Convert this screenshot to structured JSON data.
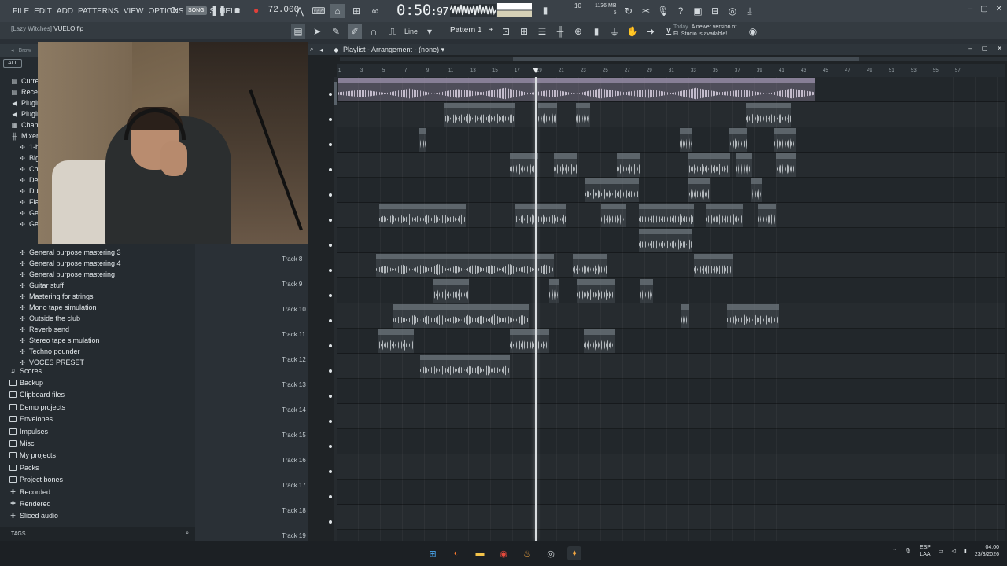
{
  "menu": [
    "FILE",
    "EDIT",
    "ADD",
    "PATTERNS",
    "VIEW",
    "OPTIONS",
    "TOOLS",
    "HELP"
  ],
  "transport": {
    "mode_label": "SONG",
    "tempo": "72.000",
    "time_main": "0:50",
    "time_fraction": ":97"
  },
  "cpu": {
    "memory": "1136 MB",
    "voices": "5",
    "top_value": "10"
  },
  "subbar": {
    "project_prefix": "[Lazy Witches]",
    "project_file": "VUELO.flp",
    "snap": "Line",
    "pattern": "Pattern 1",
    "news_today": "Today",
    "news_line1": "A newer version of",
    "news_line2": "FL Studio is available!"
  },
  "browser": {
    "head_label": "Brow",
    "filter_all": "ALL",
    "top_items": [
      {
        "label": "Curre",
        "icon": "folder-icon"
      },
      {
        "label": "Recen",
        "icon": "folder-icon"
      },
      {
        "label": "Plugin",
        "icon": "plugin-icon"
      },
      {
        "label": "Plugin",
        "icon": "plugin-icon"
      },
      {
        "label": "Chann",
        "icon": "channel-icon"
      },
      {
        "label": "Mixer",
        "icon": "mixer-icon"
      }
    ],
    "sub_items": [
      "1-b",
      "Big",
      "Cho",
      "Def",
      "Dua",
      "Fla",
      "Ger",
      "Ger"
    ],
    "fx_presets": [
      "General purpose mastering 3",
      "General purpose mastering 4",
      "General purpose mastering",
      "Guitar stuff",
      "Mastering for strings",
      "Mono tape simulation",
      "Outside the club",
      "Reverb send",
      "Stereo tape simulation",
      "Techno pounder",
      "VOCES PRESET"
    ],
    "folders": [
      "Scores",
      "Backup",
      "Clipboard files",
      "Demo projects",
      "Envelopes",
      "Impulses",
      "Misc",
      "My projects",
      "Packs",
      "Project bones",
      "Recorded",
      "Rendered",
      "Sliced audio"
    ],
    "tags_label": "TAGS"
  },
  "playlist": {
    "title": "Playlist - Arrangement",
    "arrangement": "(none)",
    "ruler_ticks": [
      "1",
      "3",
      "5",
      "7",
      "9",
      "11",
      "13",
      "15",
      "17",
      "19",
      "21",
      "23",
      "25",
      "27",
      "29",
      "31",
      "33",
      "35",
      "37",
      "39",
      "41",
      "43",
      "45",
      "47",
      "49",
      "51",
      "53",
      "55",
      "57"
    ],
    "tracks": [
      "Track 8",
      "Track 9",
      "Track 10",
      "Track 11",
      "Track 12",
      "Track 13",
      "Track 14",
      "Track 15",
      "Track 16",
      "Track 17",
      "Track 18",
      "Track 19"
    ],
    "master_clip_label": "Y2meta.app - Freestyle Boom Bap Beat _ ENTRE LETRAS _ Underground Boom Bap Instrumental Uso Libre (128 kbps)",
    "clip_labels": {
      "untitle_insert2": "untitle_insert 2",
      "unt_rt2": "unt...rt 2",
      "untitl_sert2": "untitl...sert 2",
      "vu": "VU",
      "untitle_sert2": "untitle_sert 2",
      "unt_2": "unt...2",
      "untitled_nsert2": "untitled...nsert 2",
      "vu_rt2": "VU_rt 2",
      "untitled_2_7_insert2": "untitled_2_7_Insert 2",
      "vue_2": "VUE_2"
    }
  },
  "taskbar": {
    "lang_top": "ESP",
    "lang_bottom": "LAA",
    "time": "04:00",
    "date": "23/3/2026"
  },
  "colors": {
    "playhead": "#d9dde0",
    "clip_header": "#6e767d",
    "master_clip": "#968ca5"
  }
}
